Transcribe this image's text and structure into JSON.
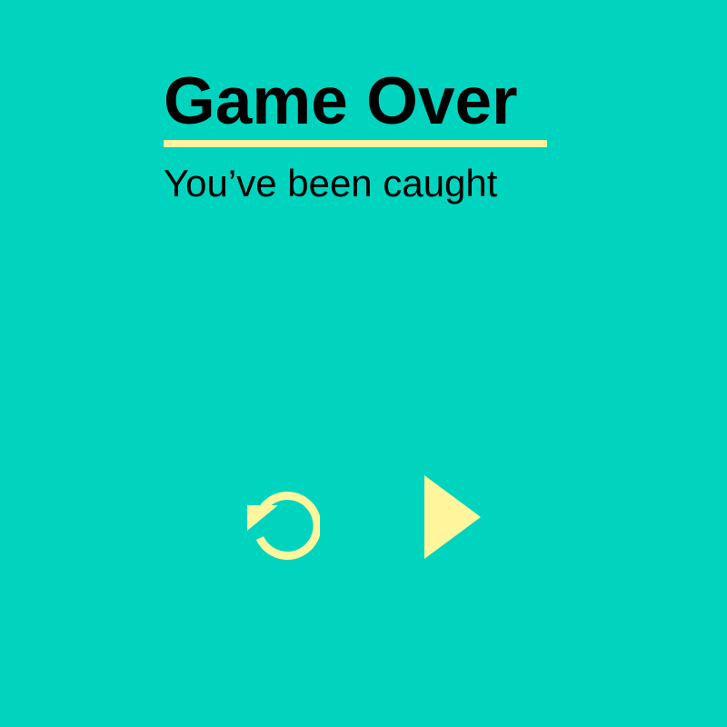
{
  "screen": {
    "title": "Game Over",
    "subtitle": "You’ve been caught",
    "background_color": "#00D4BE",
    "accent_color": "#FFF59D",
    "text_color": "#000000"
  },
  "controls": {
    "restart": {
      "icon": "restart-icon"
    },
    "play": {
      "icon": "play-icon"
    }
  }
}
